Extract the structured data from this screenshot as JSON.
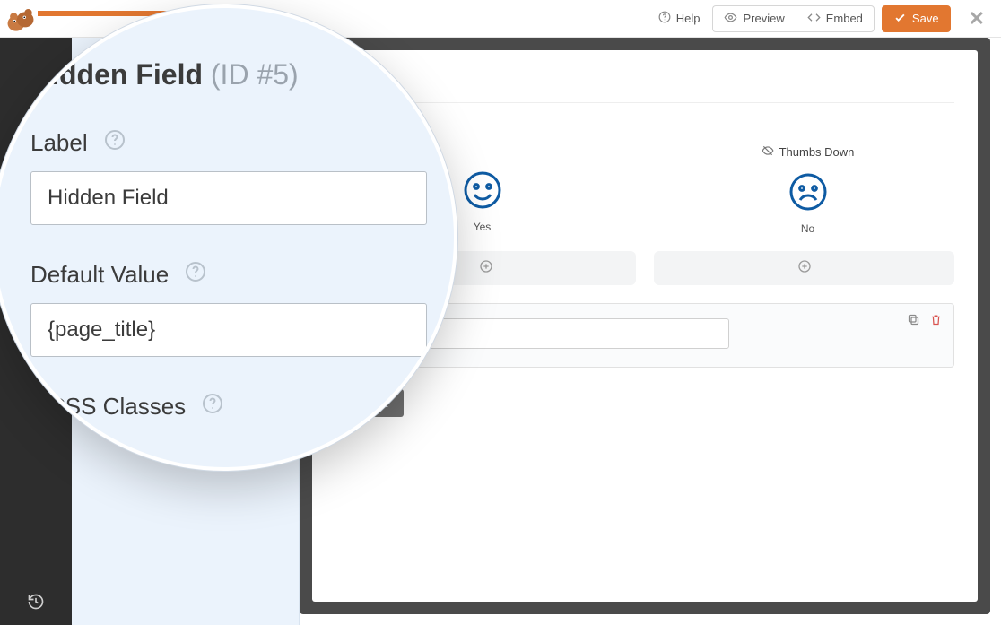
{
  "topbar": {
    "help_label": "Help",
    "preview_label": "Preview",
    "embed_label": "Embed",
    "save_label": "Save"
  },
  "panel": {
    "title": "Hidden Field",
    "id_suffix": "(ID #5)",
    "label_field_label": "Label",
    "label_field_value": "Hidden Field",
    "default_field_label": "Default Value",
    "default_field_value": "{page_title}",
    "css_field_label": "CSS Classes"
  },
  "form": {
    "thumbs_down_label": "Thumbs Down",
    "yes_caption": "Yes",
    "no_caption": "No",
    "submit_label": "Submit"
  }
}
